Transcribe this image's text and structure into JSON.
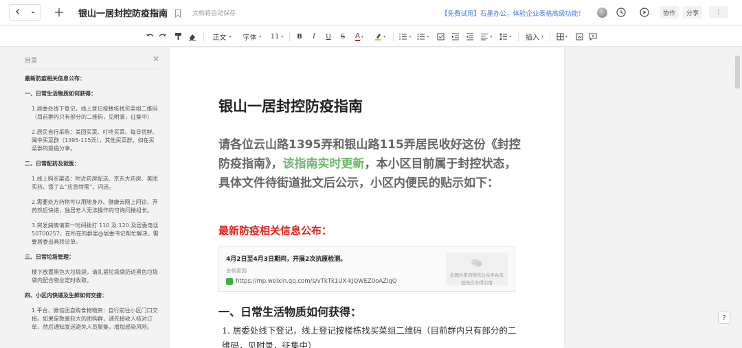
{
  "topbar": {
    "back_icon": "chevron-left-icon",
    "dropdown_icon": "caret-down-icon",
    "new_icon": "plus-icon",
    "title": "银山一居封控防疫指南",
    "autosave": "文档将自动保存",
    "promo": "【免费试用】石墨办公，体验企业表格高级功能！",
    "collab_label": "协作",
    "share_label": "分享"
  },
  "toolbar": {
    "style_label": "正文",
    "font_label": "字体",
    "size_label": "11",
    "insert_label": "插入"
  },
  "sidebar": {
    "title": "目录",
    "items": [
      {
        "text": "最新防疫相关信息公布：",
        "level": 1
      },
      {
        "text": "一、日常生活物质如何获得：",
        "level": 1
      },
      {
        "text": "1.居委处线下登记，线上登记按楼栋找买菜组二维码（目前群内只有部分的二维码，见附录，征集中）",
        "level": 2
      },
      {
        "text": "2.居民自行采购：美团买菜、叮咚买菜、每日优鲜、闽中买菜群（1395-115弄），其他买菜群，如在买菜群的提倡分享。",
        "level": 2
      },
      {
        "text": "二、日常配药及就医：",
        "level": 1
      },
      {
        "text": "1.线上购买渠道：附近药房配送、京东大药房、美团买药、饿了么“应急特需”、闪送。",
        "level": 2
      },
      {
        "text": "2.需要处方药物可以用随身办、健康云网上问诊、开药然后快递，独居老人无法操作的可询问楼组长。",
        "level": 2
      },
      {
        "text": "3.突发病情请第一时间拨打 110 及 120 及居委电话 50700257，在所在的群里@居委书记帮忙解决，需要居委出具转诊单。",
        "level": 2
      },
      {
        "text": "三、日常垃圾管理：",
        "level": 1
      },
      {
        "text": "楼下放置黑色大垃圾袋，请扎紧垃圾袋扔进黑色垃圾袋内配合物业定时收取。",
        "level": 2
      },
      {
        "text": "四、小区内快递及生鲜如何交接：",
        "level": 1
      },
      {
        "text": "1.平台、微信团自购食物物资：自行前往小区门口交接。如果是数量较大的团购群，请先接收人核对订单，然后通知发送避免人员聚集，增加感染风险。",
        "level": 2
      }
    ]
  },
  "document": {
    "title": "银山一居封控防疫指南",
    "intro_part1": "请各位云山路1395弄和银山路115弄居民收好这份《封控防疫指南》，",
    "intro_green": "该指南实时更新",
    "intro_part2": "，本小区目前属于封控状态，具体文件待街道批文后公示，小区内便民的贴示如下：",
    "section_red": "最新防疫相关信息公布：",
    "card": {
      "title": "4月2日至4月3日期间，开展2次抗原检测。",
      "source": "金杨家园",
      "url": "https://mp.weixin.qq.com/s/vTkTk1UX-kJQWEZ0oAZIqQ",
      "thumb_text": "此图片来自微信公众平台未经允许不得引用"
    },
    "h2": "一、日常生活物质如何获得：",
    "li1": "1. 居委处线下登记，线上登记按楼栋找买菜组二维码（目前群内只有部分的二维码，见附录，征集中）"
  },
  "colors": {
    "accent": "#3b7de0",
    "red_heading": "#e0231b",
    "green_highlight": "#6fb86f",
    "intro_text": "#666666"
  }
}
